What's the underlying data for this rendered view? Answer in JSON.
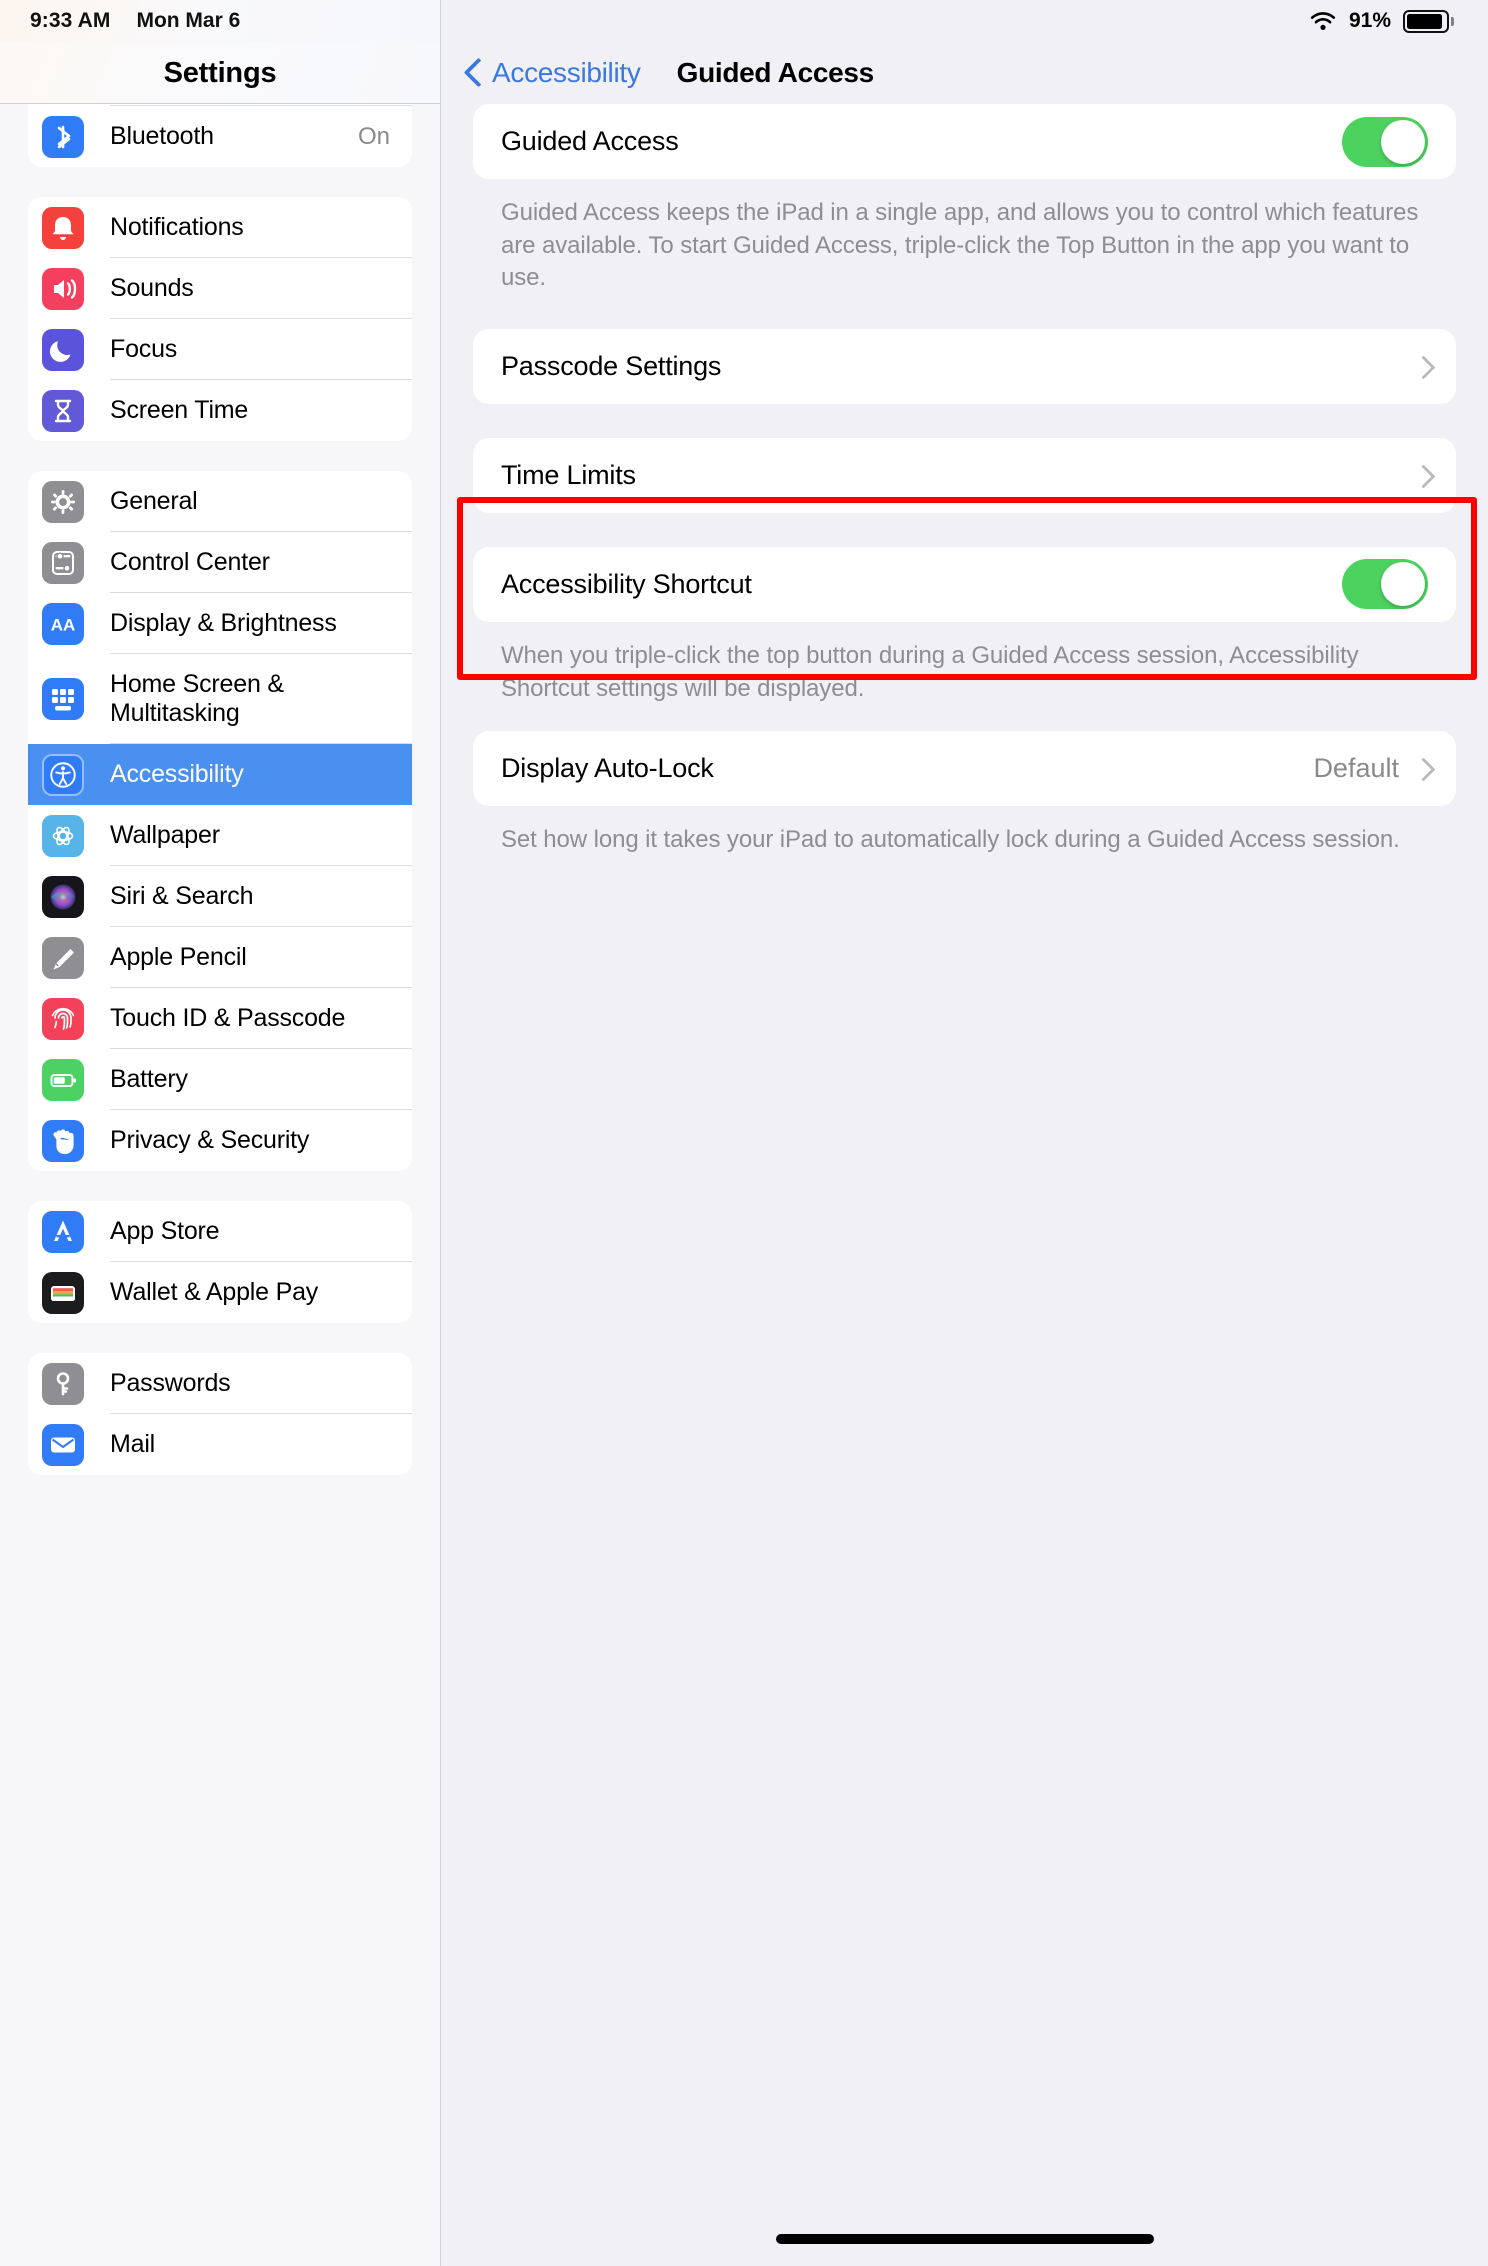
{
  "status_bar": {
    "time": "9:33 AM",
    "date": "Mon Mar 6",
    "wifi_icon": "wifi-icon",
    "battery_percent": "91%",
    "battery_level": 91
  },
  "sidebar": {
    "title": "Settings",
    "groups": [
      {
        "partial_top": true,
        "items": [
          {
            "label": "",
            "value": "",
            "icon": "bluetooth-partial-icon",
            "icon_color": "#2f7cf6",
            "partial": true
          },
          {
            "label": "Bluetooth",
            "value": "On",
            "icon": "bluetooth-icon",
            "icon_color": "#2f7cf6"
          }
        ]
      },
      {
        "items": [
          {
            "label": "Notifications",
            "value": "",
            "icon": "notifications-icon",
            "icon_color": "#f4413c"
          },
          {
            "label": "Sounds",
            "value": "",
            "icon": "sounds-icon",
            "icon_color": "#f43f5e"
          },
          {
            "label": "Focus",
            "value": "",
            "icon": "focus-icon",
            "icon_color": "#5b54da"
          },
          {
            "label": "Screen Time",
            "value": "",
            "icon": "screen-time-icon",
            "icon_color": "#6159d6"
          }
        ]
      },
      {
        "items": [
          {
            "label": "General",
            "value": "",
            "icon": "general-gear-icon",
            "icon_color": "#8e8e93"
          },
          {
            "label": "Control Center",
            "value": "",
            "icon": "control-center-icon",
            "icon_color": "#8e8e93"
          },
          {
            "label": "Display & Brightness",
            "value": "",
            "icon": "display-brightness-icon",
            "icon_color": "#2f7cf6"
          },
          {
            "label": "Home Screen & Multitasking",
            "value": "",
            "icon": "home-screen-icon",
            "icon_color": "#2f7cf6",
            "two_line": true
          },
          {
            "label": "Accessibility",
            "value": "",
            "icon": "accessibility-icon",
            "icon_color": "#2f7cf6",
            "selected": true
          },
          {
            "label": "Wallpaper",
            "value": "",
            "icon": "wallpaper-icon",
            "icon_color": "#56b4e8"
          },
          {
            "label": "Siri & Search",
            "value": "",
            "icon": "siri-icon",
            "icon_color": "#1c1c1e"
          },
          {
            "label": "Apple Pencil",
            "value": "",
            "icon": "apple-pencil-icon",
            "icon_color": "#8e8e93"
          },
          {
            "label": "Touch ID & Passcode",
            "value": "",
            "icon": "touch-id-icon",
            "icon_color": "#f4415a"
          },
          {
            "label": "Battery",
            "value": "",
            "icon": "battery-icon",
            "icon_color": "#4cd264"
          },
          {
            "label": "Privacy & Security",
            "value": "",
            "icon": "privacy-security-icon",
            "icon_color": "#2f7cf6"
          }
        ]
      },
      {
        "items": [
          {
            "label": "App Store",
            "value": "",
            "icon": "app-store-icon",
            "icon_color": "#2f7cf6"
          },
          {
            "label": "Wallet & Apple Pay",
            "value": "",
            "icon": "wallet-icon",
            "icon_color": "#1c1c1e"
          }
        ]
      },
      {
        "items": [
          {
            "label": "Passwords",
            "value": "",
            "icon": "passwords-key-icon",
            "icon_color": "#8e8e93"
          },
          {
            "label": "Mail",
            "value": "",
            "icon": "mail-icon",
            "icon_color": "#2f7cf6"
          }
        ]
      }
    ]
  },
  "main": {
    "back_label": "Accessibility",
    "back_icon": "chevron-left-icon",
    "title": "Guided Access",
    "sections": [
      {
        "rows": [
          {
            "label": "Guided Access",
            "type": "toggle",
            "value": "on"
          }
        ],
        "footer": "Guided Access keeps the iPad in a single app, and allows you to control which features are available. To start Guided Access, triple-click the Top Button in the app you want to use."
      },
      {
        "rows": [
          {
            "label": "Passcode Settings",
            "type": "disclosure",
            "value": ""
          }
        ],
        "footer": ""
      },
      {
        "rows": [
          {
            "label": "Time Limits",
            "type": "disclosure",
            "value": ""
          }
        ],
        "footer": ""
      },
      {
        "highlighted": true,
        "rows": [
          {
            "label": "Accessibility Shortcut",
            "type": "toggle",
            "value": "on"
          }
        ],
        "footer": "When you triple-click the top button during a Guided Access session, Accessibility Shortcut settings will be displayed."
      },
      {
        "rows": [
          {
            "label": "Display Auto-Lock",
            "type": "disclosure",
            "value": "Default"
          }
        ],
        "footer": "Set how long it takes your iPad to automatically lock during a Guided Access session."
      }
    ]
  },
  "colors": {
    "accent_blue": "#3b78e0",
    "toggle_green": "#4cd25f",
    "selected_row": "#4a90f0",
    "highlight_red": "#ff0000",
    "panel_bg": "#f1f1f5",
    "sidebar_bg": "#f7f7f9"
  }
}
